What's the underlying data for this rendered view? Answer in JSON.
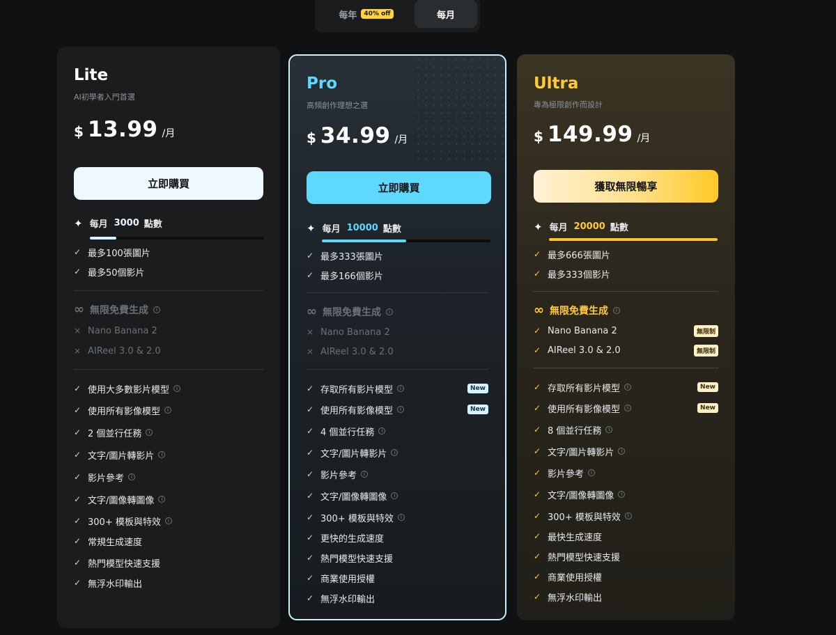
{
  "toggle": {
    "yearly": "每年",
    "yearly_badge": "40% off",
    "monthly": "每月"
  },
  "plans": {
    "lite": {
      "name": "Lite",
      "subtitle": "AI初學者入門首選",
      "currency": "$",
      "price": "13.99",
      "period": "/月",
      "button": "立即購買",
      "credits_prefix": "每月",
      "credits": "3000",
      "credits_unit": "點數",
      "credits_level": 0.15,
      "quota": [
        "最多100張圖片",
        "最多50個影片"
      ],
      "unlimited_title": "無限免費生成",
      "unlimited_items": [
        "Nano Banana 2",
        "AIReel 3.0 & 2.0"
      ],
      "features": [
        "使用大多數影片模型",
        "使用所有影像模型",
        "2 個並行任務",
        "文字/圖片轉影片",
        "影片參考",
        "文字/圖像轉圖像",
        "300+ 模板與特效",
        "常規生成速度",
        "熱門模型快速支援",
        "無浮水印輸出"
      ]
    },
    "pro": {
      "name": "Pro",
      "subtitle": "高頻創作理想之選",
      "currency": "$",
      "price": "34.99",
      "period": "/月",
      "button": "立即購買",
      "credits_prefix": "每月",
      "credits": "10000",
      "credits_unit": "點數",
      "credits_level": 0.5,
      "quota": [
        "最多333張圖片",
        "最多166個影片"
      ],
      "unlimited_title": "無限免費生成",
      "unlimited_items": [
        "Nano Banana 2",
        "AIReel 3.0 & 2.0"
      ],
      "features": [
        "存取所有影片模型",
        "使用所有影像模型",
        "4 個並行任務",
        "文字/圖片轉影片",
        "影片參考",
        "文字/圖像轉圖像",
        "300+ 模板與特效",
        "更快的生成速度",
        "熱門模型快速支援",
        "商業使用授權",
        "無浮水印輸出"
      ],
      "new_tag": "New"
    },
    "ultra": {
      "name": "Ultra",
      "subtitle": "專為極限創作而設計",
      "currency": "$",
      "price": "149.99",
      "period": "/月",
      "button": "獲取無限暢享",
      "credits_prefix": "每月",
      "credits": "20000",
      "credits_unit": "點數",
      "credits_level": 1.0,
      "quota": [
        "最多666張圖片",
        "最多333個影片"
      ],
      "unlimited_title": "無限免費生成",
      "unlimited_items": [
        "Nano Banana 2",
        "AIReel 3.0 & 2.0"
      ],
      "unlimited_tag": "無限制",
      "features": [
        "存取所有影片模型",
        "使用所有影像模型",
        "8 個並行任務",
        "文字/圖片轉影片",
        "影片參考",
        "文字/圖像轉圖像",
        "300+ 模板與特效",
        "最快生成速度",
        "熱門模型快速支援",
        "商業使用授權",
        "無浮水印輸出"
      ],
      "new_tag": "New"
    }
  },
  "colors": {
    "pro_accent": "#5fd8ff",
    "ultra_accent": "#ffc93a",
    "background": "#0f1112"
  }
}
